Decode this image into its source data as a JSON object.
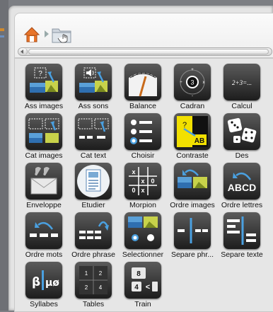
{
  "toolbar": {
    "home_icon": "home-icon",
    "folder_icon": "folder-icon"
  },
  "apps": [
    {
      "name": "ass-images",
      "label": "Ass images",
      "icon": "assign-images-icon"
    },
    {
      "name": "ass-sons",
      "label": "Ass sons",
      "icon": "assign-sounds-icon"
    },
    {
      "name": "balance",
      "label": "Balance",
      "icon": "gauge-icon"
    },
    {
      "name": "cadran",
      "label": "Cadran",
      "icon": "dial-icon"
    },
    {
      "name": "calcul",
      "label": "Calcul",
      "icon": "calculation-icon"
    },
    {
      "name": "cat-images",
      "label": "Cat images",
      "icon": "categorize-images-icon"
    },
    {
      "name": "cat-text",
      "label": "Cat text",
      "icon": "categorize-text-icon"
    },
    {
      "name": "choisir",
      "label": "Choisir",
      "icon": "choose-list-icon"
    },
    {
      "name": "contraste",
      "label": "Contraste",
      "icon": "contrast-icon"
    },
    {
      "name": "des",
      "label": "Des",
      "icon": "dice-icon"
    },
    {
      "name": "enveloppe",
      "label": "Enveloppe",
      "icon": "envelope-icon"
    },
    {
      "name": "etudier",
      "label": "Etudier",
      "icon": "study-page-icon"
    },
    {
      "name": "morpion",
      "label": "Morpion",
      "icon": "tic-tac-toe-icon"
    },
    {
      "name": "ordre-images",
      "label": "Ordre images",
      "icon": "order-images-icon"
    },
    {
      "name": "ordre-lettres",
      "label": "Ordre lettres",
      "icon": "order-letters-icon"
    },
    {
      "name": "ordre-mots",
      "label": "Ordre mots",
      "icon": "order-words-icon"
    },
    {
      "name": "ordre-phrase",
      "label": "Ordre phrase",
      "icon": "order-sentence-icon"
    },
    {
      "name": "selectionner",
      "label": "Selectionner",
      "icon": "select-icon"
    },
    {
      "name": "separe-phr",
      "label": "Separe phr...",
      "icon": "split-sentence-icon"
    },
    {
      "name": "separe-texte",
      "label": "Separe texte",
      "icon": "split-text-icon"
    },
    {
      "name": "syllabes",
      "label": "Syllabes",
      "icon": "syllables-icon"
    },
    {
      "name": "tables",
      "label": "Tables",
      "icon": "times-tables-icon"
    },
    {
      "name": "train",
      "label": "Train",
      "icon": "train-icon"
    }
  ],
  "tile_text": {
    "calcul": "2+3=...",
    "ordre_lettres": "ABCD",
    "contraste": "AB",
    "syllabes": "β|μø",
    "cadran_num": "3"
  }
}
